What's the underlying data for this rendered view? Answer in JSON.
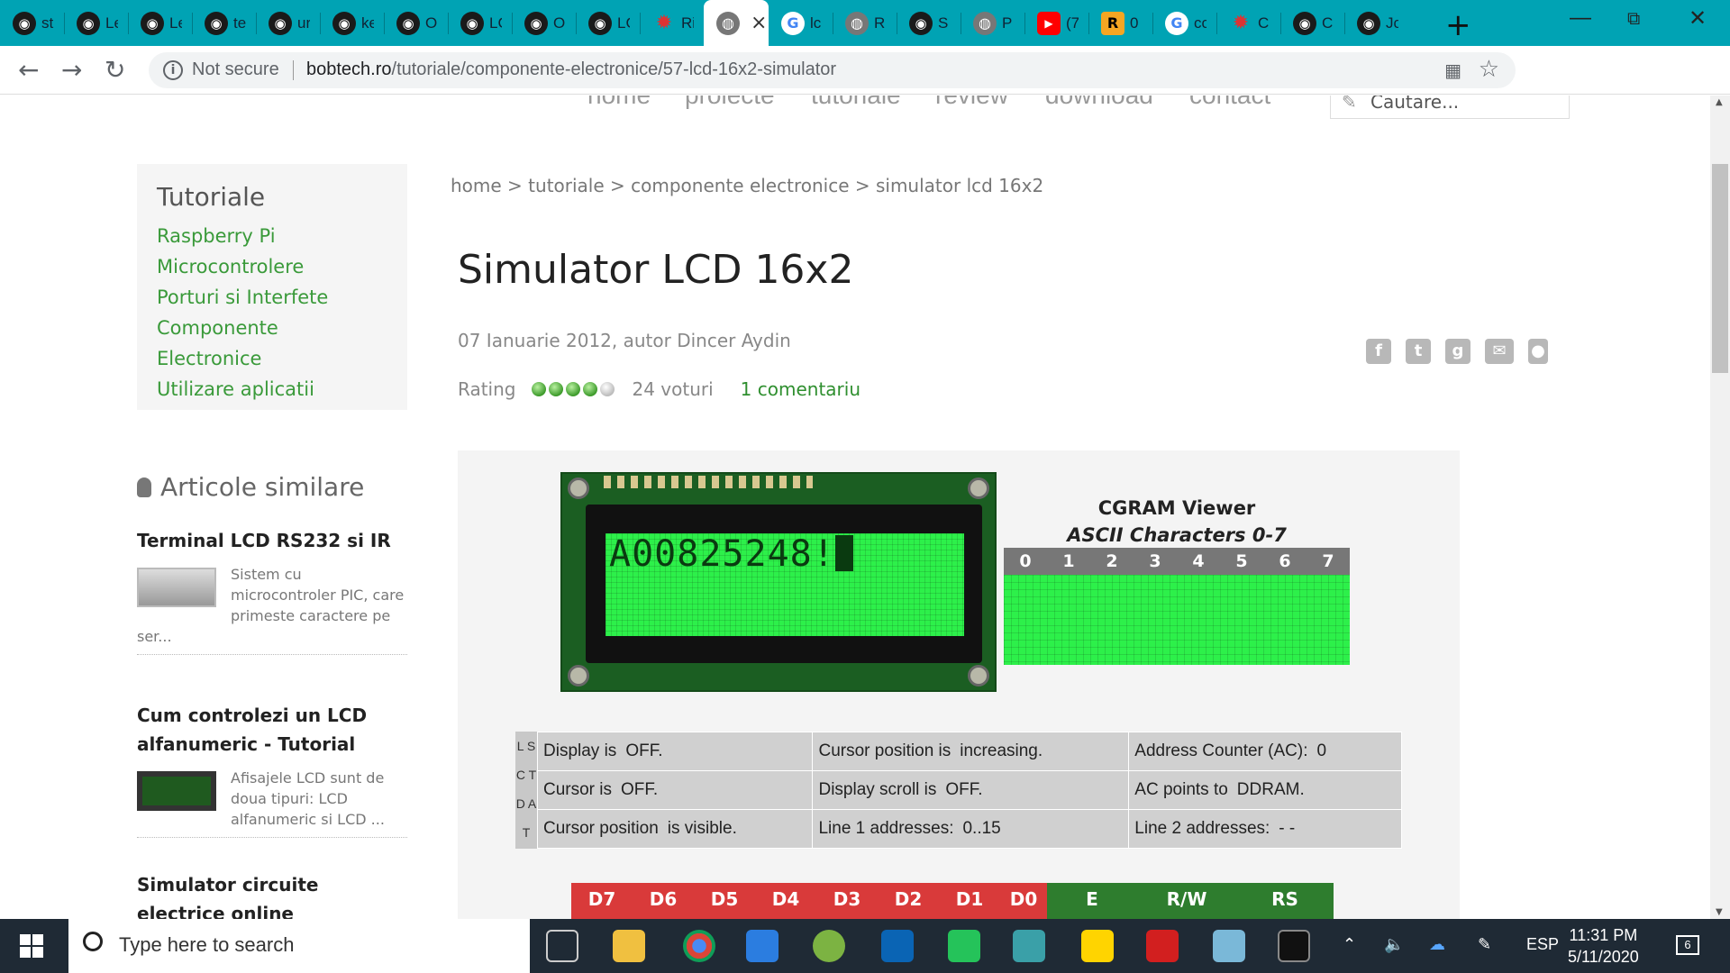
{
  "browser": {
    "tabs": [
      {
        "icon": "github-icon",
        "label": "st"
      },
      {
        "icon": "github-icon",
        "label": "Le"
      },
      {
        "icon": "github-icon",
        "label": "Le"
      },
      {
        "icon": "github-icon",
        "label": "te"
      },
      {
        "icon": "github-icon",
        "label": "ur"
      },
      {
        "icon": "github-icon",
        "label": "ke"
      },
      {
        "icon": "github-icon",
        "label": "O"
      },
      {
        "icon": "github-icon",
        "label": "LC"
      },
      {
        "icon": "github-icon",
        "label": "O"
      },
      {
        "icon": "github-icon",
        "label": "LC"
      },
      {
        "icon": "gear-icon",
        "label": "Ri"
      },
      {
        "icon": "globe-icon",
        "label": ""
      },
      {
        "icon": "google-icon",
        "label": "lc"
      },
      {
        "icon": "globe-icon",
        "label": "R"
      },
      {
        "icon": "github-icon",
        "label": "S"
      },
      {
        "icon": "globe-icon",
        "label": "P"
      },
      {
        "icon": "youtube-icon",
        "label": "(7"
      },
      {
        "icon": "r-icon",
        "label": "0"
      },
      {
        "icon": "google-icon",
        "label": "cc"
      },
      {
        "icon": "gear-icon",
        "label": "C"
      },
      {
        "icon": "github-icon",
        "label": "C"
      },
      {
        "icon": "github-icon",
        "label": "Jc"
      }
    ],
    "new_tab_label": "+",
    "security_label": "Not secure",
    "url_host": "bobtech.ro",
    "url_path": "/tutoriale/componente-electronice/57-lcd-16x2-simulator"
  },
  "site": {
    "nav": [
      "home",
      "proiecte",
      "tutoriale",
      "review",
      "download",
      "contact"
    ],
    "search_placeholder": "Cautare..."
  },
  "sidebar": {
    "title": "Tutoriale",
    "links": [
      "Raspberry Pi",
      "Microcontrolere",
      "Porturi si Interfete",
      "Componente Electronice",
      "Utilizare aplicatii"
    ],
    "similar_title": "Articole similare",
    "articles": [
      {
        "title": "Terminal LCD RS232 si IR",
        "desc": "Sistem cu microcontroler PIC, care primeste caractere pe ser..."
      },
      {
        "title": "Cum controlezi un LCD alfanumeric - Tutorial",
        "desc": "Afisajele LCD sunt de doua tipuri: LCD alfanumeric si LCD ..."
      },
      {
        "title": "Simulator circuite electrice online",
        "desc": ""
      }
    ]
  },
  "article": {
    "breadcrumb": "home > tutoriale > componente electronice > simulator lcd 16x2",
    "title": "Simulator LCD 16x2",
    "date_author": "07 Ianuarie 2012,  autor Dincer Aydin",
    "rating_label": "Rating",
    "rating_value": 4,
    "rating_max": 5,
    "votes": "24 voturi",
    "comments": "1 comentariu"
  },
  "simulator": {
    "lcd_text": "A00825248!",
    "cgram_title": "CGRAM Viewer",
    "cgram_subtitle": "ASCII Characters 0-7",
    "cgram_cols": [
      "0",
      "1",
      "2",
      "3",
      "4",
      "5",
      "6",
      "7"
    ],
    "status_side": "L S C T D A T",
    "status": [
      [
        [
          "Display is",
          "OFF."
        ],
        [
          "Cursor position is",
          "increasing."
        ],
        [
          "Address Counter (AC):",
          "0"
        ]
      ],
      [
        [
          "Cursor is",
          "OFF."
        ],
        [
          "Display scroll is",
          "OFF."
        ],
        [
          "AC points to",
          "DDRAM."
        ]
      ],
      [
        [
          "Cursor position",
          "is visible."
        ],
        [
          "Line 1 addresses:",
          "0..15"
        ],
        [
          "Line 2 addresses:",
          "- -"
        ]
      ]
    ],
    "pins": [
      "D7",
      "D6",
      "D5",
      "D4",
      "D3",
      "D2",
      "D1",
      "D0",
      "E",
      "R/W",
      "RS"
    ]
  },
  "taskbar": {
    "search_placeholder": "Type here to search",
    "lang": "ESP",
    "time": "11:31 PM",
    "date": "5/11/2020",
    "notifications": "6"
  },
  "colors": {
    "tab_bar": "#00a3b4",
    "link_green": "#3a9a3a",
    "lcd_green": "#2df04a",
    "pin_red": "#d93a3a",
    "pin_green": "#2e7d2e"
  }
}
